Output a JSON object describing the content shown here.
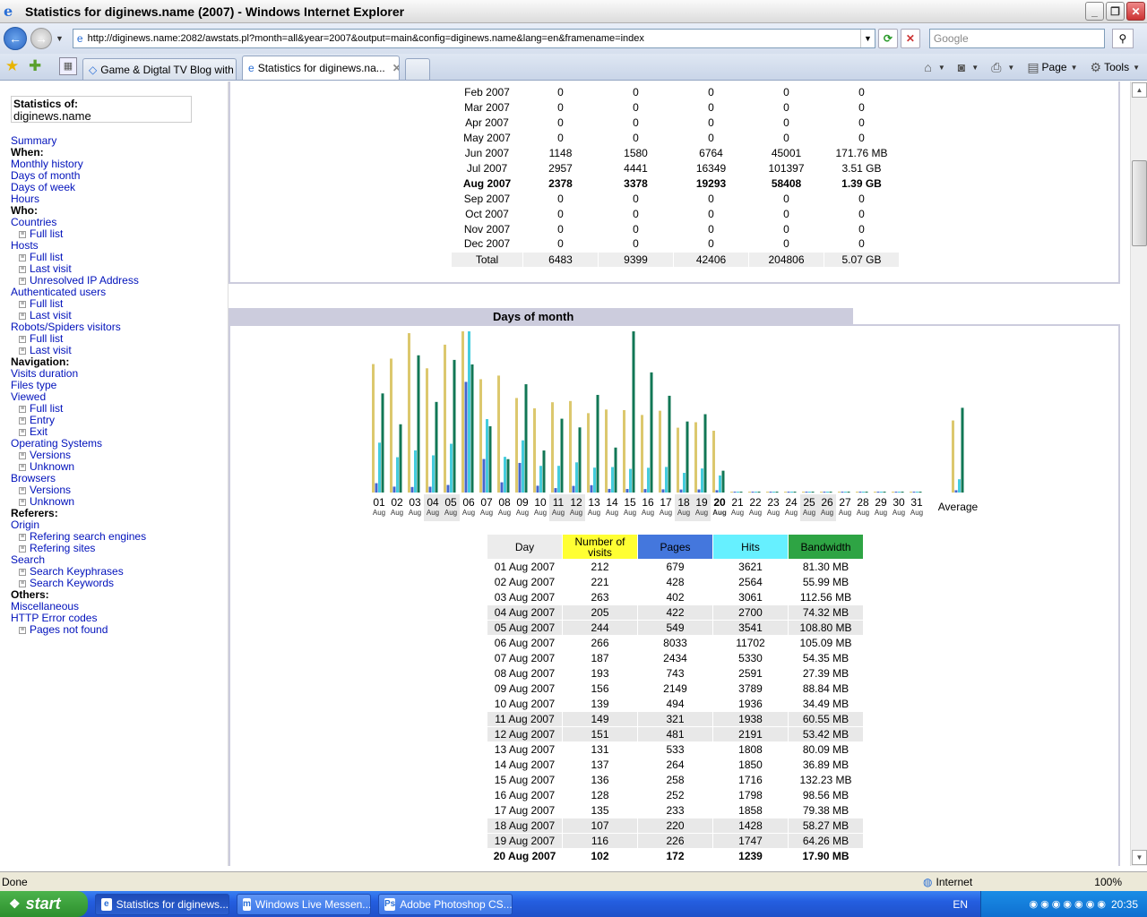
{
  "window": {
    "title": "Statistics for diginews.name (2007) - Windows Internet Explorer"
  },
  "address": {
    "url": "http://diginews.name:2082/awstats.pl?month=all&year=2007&output=main&config=diginews.name&lang=en&framename=index",
    "search_placeholder": "Google"
  },
  "tabs": [
    {
      "label": "Game & Digtal TV Blog with o..."
    },
    {
      "label": "Statistics for diginews.na..."
    }
  ],
  "commands": {
    "page": "Page",
    "tools": "Tools"
  },
  "sidebar": {
    "stats_label": "Statistics of:",
    "site": "diginews.name",
    "items": [
      {
        "t": "link",
        "label": "Summary"
      },
      {
        "t": "head",
        "label": "When:"
      },
      {
        "t": "link",
        "label": "Monthly history"
      },
      {
        "t": "link",
        "label": "Days of month"
      },
      {
        "t": "link",
        "label": "Days of week"
      },
      {
        "t": "link",
        "label": "Hours"
      },
      {
        "t": "head",
        "label": "Who:"
      },
      {
        "t": "link",
        "label": "Countries"
      },
      {
        "t": "sub",
        "label": "Full list"
      },
      {
        "t": "link",
        "label": "Hosts"
      },
      {
        "t": "sub",
        "label": "Full list"
      },
      {
        "t": "sub",
        "label": "Last visit"
      },
      {
        "t": "sub",
        "label": "Unresolved IP Address"
      },
      {
        "t": "link",
        "label": "Authenticated users"
      },
      {
        "t": "sub",
        "label": "Full list"
      },
      {
        "t": "sub",
        "label": "Last visit"
      },
      {
        "t": "link",
        "label": "Robots/Spiders visitors"
      },
      {
        "t": "sub",
        "label": "Full list"
      },
      {
        "t": "sub",
        "label": "Last visit"
      },
      {
        "t": "head",
        "label": "Navigation:"
      },
      {
        "t": "link",
        "label": "Visits duration"
      },
      {
        "t": "link",
        "label": "Files type"
      },
      {
        "t": "link",
        "label": "Viewed"
      },
      {
        "t": "sub",
        "label": "Full list"
      },
      {
        "t": "sub",
        "label": "Entry"
      },
      {
        "t": "sub",
        "label": "Exit"
      },
      {
        "t": "link",
        "label": "Operating Systems"
      },
      {
        "t": "sub",
        "label": "Versions"
      },
      {
        "t": "sub",
        "label": "Unknown"
      },
      {
        "t": "link",
        "label": "Browsers"
      },
      {
        "t": "sub",
        "label": "Versions"
      },
      {
        "t": "sub",
        "label": "Unknown"
      },
      {
        "t": "head",
        "label": "Referers:"
      },
      {
        "t": "link",
        "label": "Origin"
      },
      {
        "t": "sub",
        "label": "Refering search engines"
      },
      {
        "t": "sub",
        "label": "Refering sites"
      },
      {
        "t": "link",
        "label": "Search"
      },
      {
        "t": "sub",
        "label": "Search Keyphrases"
      },
      {
        "t": "sub",
        "label": "Search Keywords"
      },
      {
        "t": "head",
        "label": "Others:"
      },
      {
        "t": "link",
        "label": "Miscellaneous"
      },
      {
        "t": "link",
        "label": "HTTP Error codes"
      },
      {
        "t": "sub",
        "label": "Pages not found"
      }
    ]
  },
  "monthly_rows": [
    {
      "m": "Feb 2007",
      "v": "0",
      "p": "0",
      "h": "0",
      "b": "0",
      "bw": "0"
    },
    {
      "m": "Mar 2007",
      "v": "0",
      "p": "0",
      "h": "0",
      "b": "0",
      "bw": "0"
    },
    {
      "m": "Apr 2007",
      "v": "0",
      "p": "0",
      "h": "0",
      "b": "0",
      "bw": "0"
    },
    {
      "m": "May 2007",
      "v": "0",
      "p": "0",
      "h": "0",
      "b": "0",
      "bw": "0"
    },
    {
      "m": "Jun 2007",
      "v": "1148",
      "p": "1580",
      "h": "6764",
      "b": "45001",
      "bw": "171.76 MB"
    },
    {
      "m": "Jul 2007",
      "v": "2957",
      "p": "4441",
      "h": "16349",
      "b": "101397",
      "bw": "3.51 GB"
    },
    {
      "m": "Aug 2007",
      "v": "2378",
      "p": "3378",
      "h": "19293",
      "b": "58408",
      "bw": "1.39 GB",
      "bold": true
    },
    {
      "m": "Sep 2007",
      "v": "0",
      "p": "0",
      "h": "0",
      "b": "0",
      "bw": "0"
    },
    {
      "m": "Oct 2007",
      "v": "0",
      "p": "0",
      "h": "0",
      "b": "0",
      "bw": "0"
    },
    {
      "m": "Nov 2007",
      "v": "0",
      "p": "0",
      "h": "0",
      "b": "0",
      "bw": "0"
    },
    {
      "m": "Dec 2007",
      "v": "0",
      "p": "0",
      "h": "0",
      "b": "0",
      "bw": "0"
    },
    {
      "m": "Total",
      "v": "6483",
      "p": "9399",
      "h": "42406",
      "b": "204806",
      "bw": "5.07 GB",
      "total": true
    }
  ],
  "days_section": {
    "title": "Days of month",
    "average_label": "Average",
    "month_abbr": "Aug"
  },
  "chart_data": {
    "type": "bar",
    "categories": [
      "01",
      "02",
      "03",
      "04",
      "05",
      "06",
      "07",
      "08",
      "09",
      "10",
      "11",
      "12",
      "13",
      "14",
      "15",
      "16",
      "17",
      "18",
      "19",
      "20",
      "21",
      "22",
      "23",
      "24",
      "25",
      "26",
      "27",
      "28",
      "29",
      "30",
      "31"
    ],
    "weekend_days": [
      "04",
      "05",
      "11",
      "12",
      "18",
      "19",
      "25",
      "26"
    ],
    "current_day": "20",
    "series": [
      {
        "name": "Number of visits",
        "color": "#dcc86e",
        "values": [
          212,
          221,
          263,
          205,
          244,
          266,
          187,
          193,
          156,
          139,
          149,
          151,
          131,
          137,
          136,
          128,
          135,
          107,
          116,
          102,
          0,
          0,
          0,
          0,
          0,
          0,
          0,
          0,
          0,
          0,
          0
        ]
      },
      {
        "name": "Pages",
        "color": "#4466cc",
        "values": [
          679,
          428,
          402,
          422,
          549,
          8033,
          2434,
          743,
          2149,
          494,
          321,
          481,
          533,
          264,
          258,
          252,
          233,
          220,
          226,
          172,
          0,
          0,
          0,
          0,
          0,
          0,
          0,
          0,
          0,
          0,
          0
        ]
      },
      {
        "name": "Hits",
        "color": "#44ccdd",
        "values": [
          3621,
          2564,
          3061,
          2700,
          3541,
          11702,
          5330,
          2591,
          3789,
          1936,
          1938,
          2191,
          1808,
          1850,
          1716,
          1798,
          1858,
          1428,
          1747,
          1239,
          0,
          0,
          0,
          0,
          0,
          0,
          0,
          0,
          0,
          0,
          0
        ]
      },
      {
        "name": "Bandwidth",
        "color": "#117755",
        "values": [
          81.3,
          55.99,
          112.56,
          74.32,
          108.8,
          105.09,
          54.35,
          27.39,
          88.84,
          34.49,
          60.55,
          53.42,
          80.09,
          36.89,
          132.23,
          98.56,
          79.38,
          58.27,
          64.26,
          17.9,
          0,
          0,
          0,
          0,
          0,
          0,
          0,
          0,
          0,
          0,
          0
        ]
      }
    ],
    "average": {
      "visits": 118.9,
      "pages": 169,
      "hits": 965,
      "bandwidth": 69.5
    }
  },
  "day_table": {
    "headers": [
      "Day",
      "Number of visits",
      "Pages",
      "Hits",
      "Bandwidth"
    ],
    "rows": [
      {
        "d": "01 Aug 2007",
        "v": "212",
        "p": "679",
        "h": "3621",
        "bw": "81.30 MB"
      },
      {
        "d": "02 Aug 2007",
        "v": "221",
        "p": "428",
        "h": "2564",
        "bw": "55.99 MB"
      },
      {
        "d": "03 Aug 2007",
        "v": "263",
        "p": "402",
        "h": "3061",
        "bw": "112.56 MB"
      },
      {
        "d": "04 Aug 2007",
        "v": "205",
        "p": "422",
        "h": "2700",
        "bw": "74.32 MB",
        "we": true
      },
      {
        "d": "05 Aug 2007",
        "v": "244",
        "p": "549",
        "h": "3541",
        "bw": "108.80 MB",
        "we": true
      },
      {
        "d": "06 Aug 2007",
        "v": "266",
        "p": "8033",
        "h": "11702",
        "bw": "105.09 MB"
      },
      {
        "d": "07 Aug 2007",
        "v": "187",
        "p": "2434",
        "h": "5330",
        "bw": "54.35 MB"
      },
      {
        "d": "08 Aug 2007",
        "v": "193",
        "p": "743",
        "h": "2591",
        "bw": "27.39 MB"
      },
      {
        "d": "09 Aug 2007",
        "v": "156",
        "p": "2149",
        "h": "3789",
        "bw": "88.84 MB"
      },
      {
        "d": "10 Aug 2007",
        "v": "139",
        "p": "494",
        "h": "1936",
        "bw": "34.49 MB"
      },
      {
        "d": "11 Aug 2007",
        "v": "149",
        "p": "321",
        "h": "1938",
        "bw": "60.55 MB",
        "we": true
      },
      {
        "d": "12 Aug 2007",
        "v": "151",
        "p": "481",
        "h": "2191",
        "bw": "53.42 MB",
        "we": true
      },
      {
        "d": "13 Aug 2007",
        "v": "131",
        "p": "533",
        "h": "1808",
        "bw": "80.09 MB"
      },
      {
        "d": "14 Aug 2007",
        "v": "137",
        "p": "264",
        "h": "1850",
        "bw": "36.89 MB"
      },
      {
        "d": "15 Aug 2007",
        "v": "136",
        "p": "258",
        "h": "1716",
        "bw": "132.23 MB"
      },
      {
        "d": "16 Aug 2007",
        "v": "128",
        "p": "252",
        "h": "1798",
        "bw": "98.56 MB"
      },
      {
        "d": "17 Aug 2007",
        "v": "135",
        "p": "233",
        "h": "1858",
        "bw": "79.38 MB"
      },
      {
        "d": "18 Aug 2007",
        "v": "107",
        "p": "220",
        "h": "1428",
        "bw": "58.27 MB",
        "we": true
      },
      {
        "d": "19 Aug 2007",
        "v": "116",
        "p": "226",
        "h": "1747",
        "bw": "64.26 MB",
        "we": true
      },
      {
        "d": "20 Aug 2007",
        "v": "102",
        "p": "172",
        "h": "1239",
        "bw": "17.90 MB",
        "today": true
      }
    ]
  },
  "statusbar": {
    "text": "Done",
    "zone": "Internet",
    "zoom": "100%"
  },
  "taskbar": {
    "start": "start",
    "tasks": [
      {
        "label": "Statistics for diginews...",
        "icon": "e"
      },
      {
        "label": "Windows Live Messen...",
        "icon": "m"
      },
      {
        "label": "Adobe Photoshop CS...",
        "icon": "Ps"
      }
    ],
    "lang": "EN",
    "clock": "20:35"
  }
}
